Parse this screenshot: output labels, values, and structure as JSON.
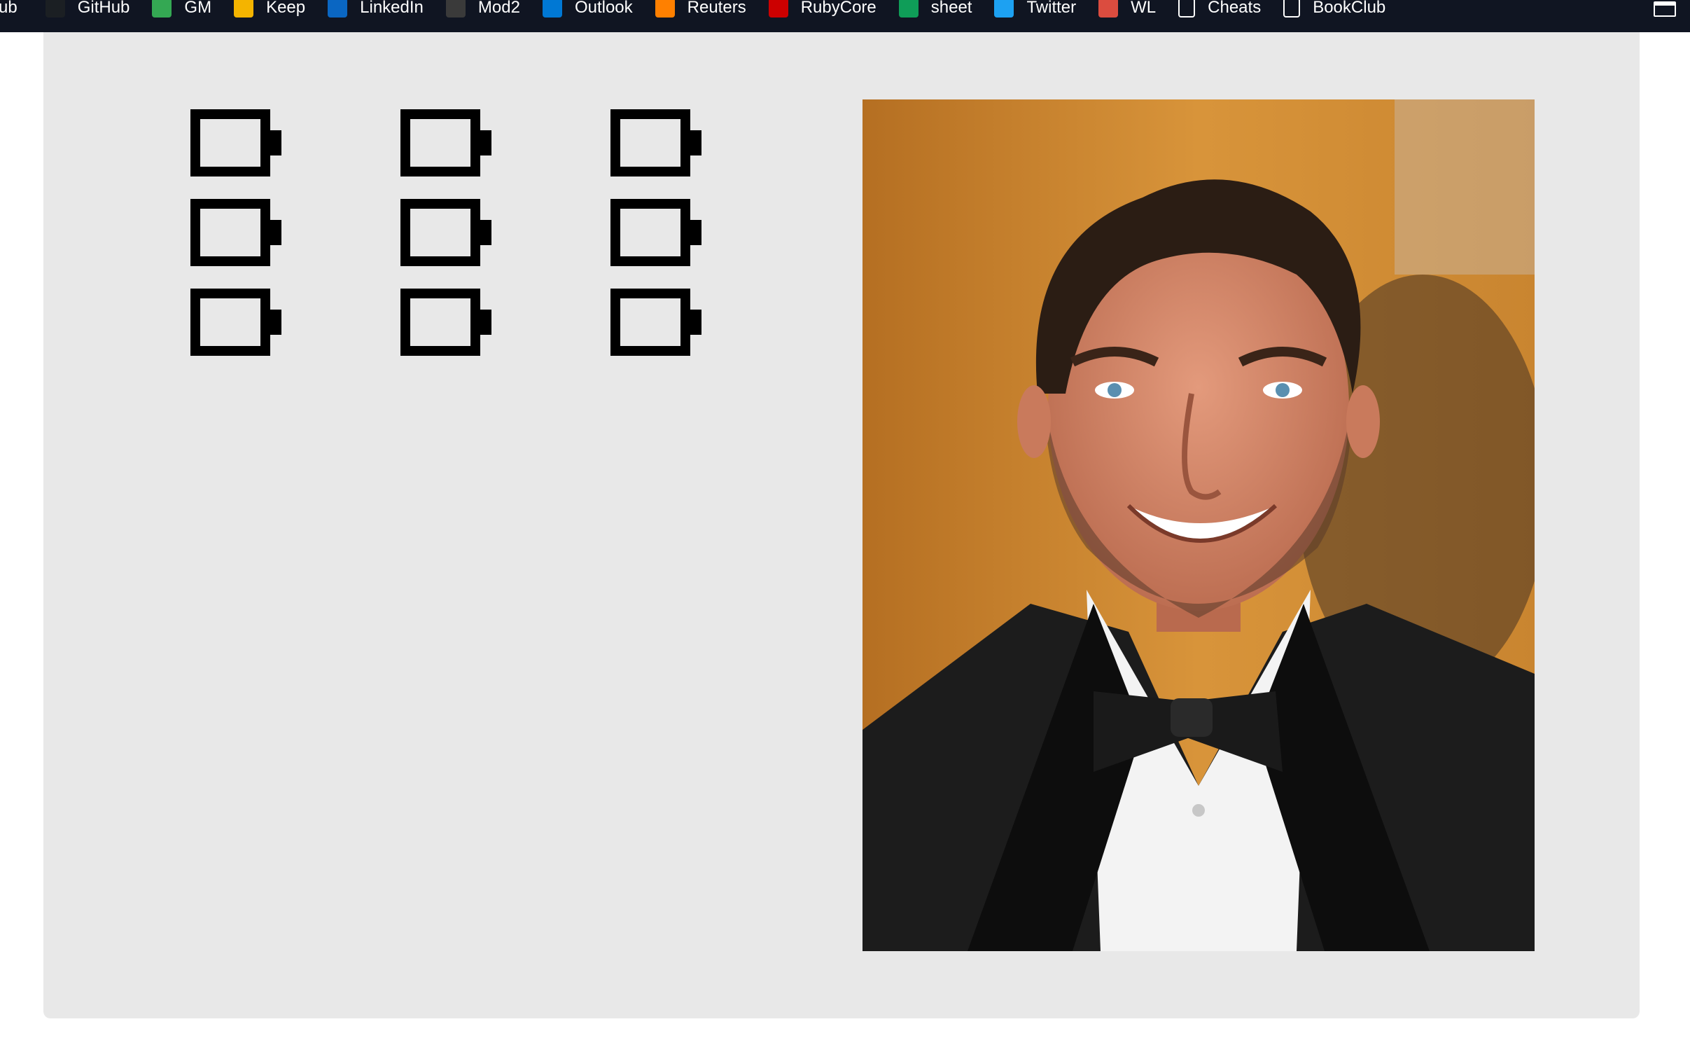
{
  "bookmarks": {
    "partial_label": "ub",
    "items": [
      {
        "label": "GitHub",
        "icon": "github-icon",
        "color": "#1b1f23"
      },
      {
        "label": "GM",
        "icon": "google-maps-icon",
        "color": "#34a853"
      },
      {
        "label": "Keep",
        "icon": "google-keep-icon",
        "color": "#f4b400"
      },
      {
        "label": "LinkedIn",
        "icon": "linkedin-icon",
        "color": "#0a66c2"
      },
      {
        "label": "Mod2",
        "icon": "turing-icon",
        "color": "#3a3a3a"
      },
      {
        "label": "Outlook",
        "icon": "outlook-icon",
        "color": "#0078d4"
      },
      {
        "label": "Reuters",
        "icon": "reuters-icon",
        "color": "#ff8000"
      },
      {
        "label": "RubyCore",
        "icon": "ruby-icon",
        "color": "#cc0000"
      },
      {
        "label": "sheet",
        "icon": "google-sheets-icon",
        "color": "#0f9d58"
      },
      {
        "label": "Twitter",
        "icon": "twitter-icon",
        "color": "#1da1f2"
      },
      {
        "label": "WL",
        "icon": "wunderlist-icon",
        "color": "#db4c3f"
      },
      {
        "label": "Cheats",
        "icon": "folder-icon",
        "color": "#ffffff"
      },
      {
        "label": "BookClub",
        "icon": "document-icon",
        "color": "#ffffff"
      }
    ]
  },
  "batteries": {
    "count": 9,
    "icon": "battery-empty-icon"
  },
  "colors": {
    "bookmarks_bg": "#101522",
    "panel_bg": "#e8e8e8",
    "battery": "#000000"
  }
}
